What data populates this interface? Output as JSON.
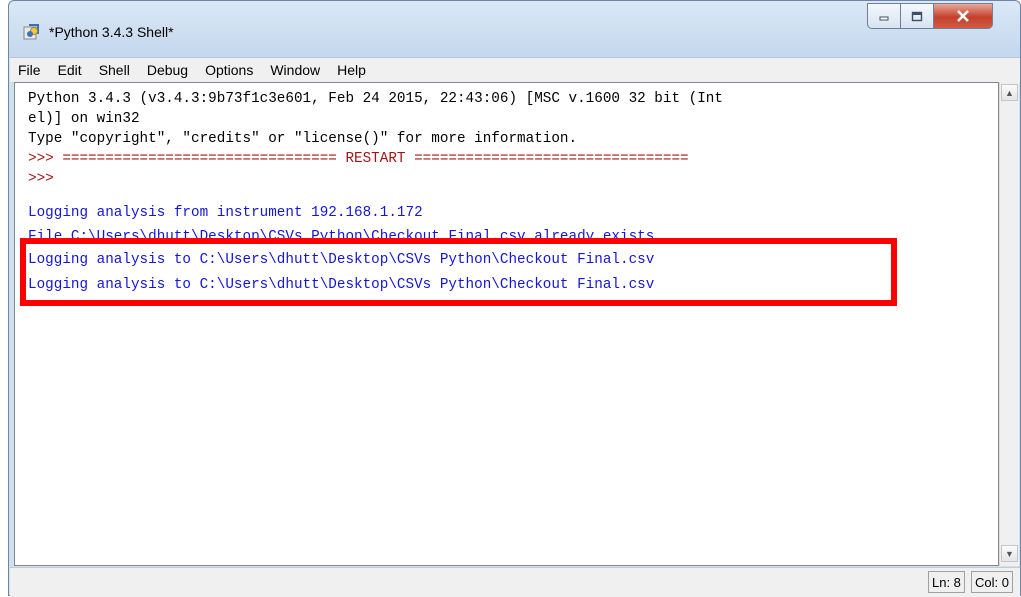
{
  "window": {
    "title": "*Python 3.4.3 Shell*",
    "controls": {
      "minimize": "–",
      "maximize": "□",
      "close": "X"
    }
  },
  "menu": [
    "File",
    "Edit",
    "Shell",
    "Debug",
    "Options",
    "Window",
    "Help"
  ],
  "shell": {
    "lines": [
      {
        "text": "Python 3.4.3 (v3.4.3:9b73f1c3e601, Feb 24 2015, 22:43:06) [MSC v.1600 32 bit (Int",
        "style": "black"
      },
      {
        "text": "el)] on win32",
        "style": "black"
      },
      {
        "text": "Type \"copyright\", \"credits\" or \"license()\" for more information.",
        "style": "black"
      },
      {
        "text": ">>> ================================ RESTART ================================",
        "style": "prompt"
      },
      {
        "text": ">>>",
        "style": "prompt"
      },
      {
        "text": "Logging analysis from instrument 192.168.1.172",
        "style": "blue"
      },
      {
        "text": "File C:\\Users\\dhutt\\Desktop\\CSVs Python\\Checkout Final.csv already exists",
        "style": "blue"
      },
      {
        "text": "Logging analysis to C:\\Users\\dhutt\\Desktop\\CSVs Python\\Checkout Final.csv",
        "style": "blue"
      },
      {
        "text": "Logging analysis to C:\\Users\\dhutt\\Desktop\\CSVs Python\\Checkout Final.csv",
        "style": "blue"
      }
    ]
  },
  "status": {
    "line": "Ln: 8",
    "col": "Col: 0"
  },
  "colors": {
    "output": "#1515d8",
    "prompt": "#a31515",
    "highlight": "#ff0000"
  },
  "icons": {
    "app": "python-idle-icon"
  }
}
